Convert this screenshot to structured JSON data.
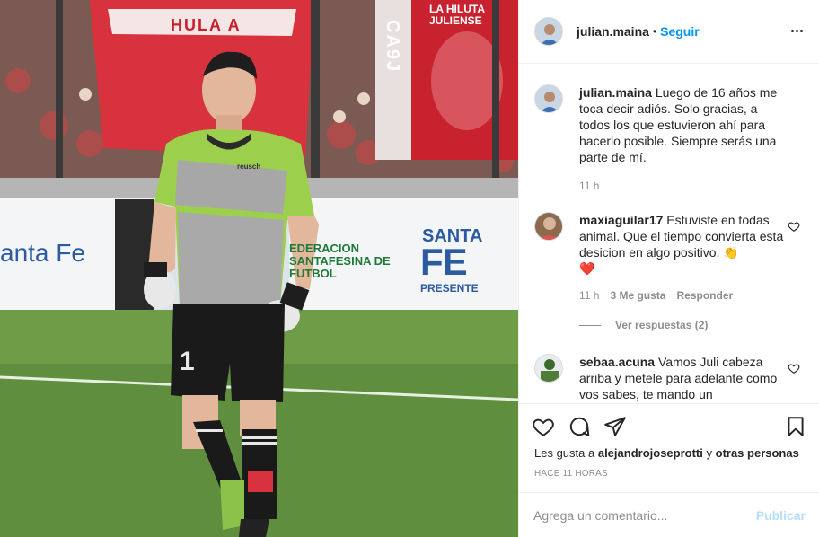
{
  "photo": {
    "banners": {
      "left": "HULA A",
      "right_vertical": "CA9J",
      "right_top": "LA HILUTA JULIENSE"
    },
    "boards": {
      "santa_fe": "anta Fe",
      "federacion": "EDERACION SANTAFESINA DE FUTBOL",
      "santa": "SANTA",
      "fe": "FE",
      "presente": "PRESENTE"
    },
    "kit": {
      "brand": "reusch",
      "number": "1"
    }
  },
  "header": {
    "username": "julian.maina",
    "separator": "•",
    "follow_label": "Seguir",
    "more_icon": "more-horizontal-icon"
  },
  "caption": {
    "username": "julian.maina",
    "text": "Luego de 16 años me toca decir adiós. Solo gracias, a todos los que estuvieron ahí para hacerlo posible. Siempre serás una parte de mí.",
    "time": "11 h"
  },
  "comments": [
    {
      "username": "maxiaguilar17",
      "text": "Estuviste en todas animal. Que el tiempo convierta esta desicion en algo positivo. 👏",
      "emoji_line": "❤️",
      "time": "11 h",
      "likes": "3 Me gusta",
      "reply_label": "Responder",
      "view_replies": "Ver respuestas (2)"
    },
    {
      "username": "sebaa.acuna",
      "text": "Vamos Juli cabeza arriba y metele para adelante como vos sabes, te mando un"
    }
  ],
  "actions": {
    "icons": [
      "heart-icon",
      "comment-icon",
      "share-icon",
      "bookmark-icon"
    ],
    "likes_prefix": "Les gusta a",
    "likes_user": "alejandrojoseprotti",
    "likes_connector": "y",
    "likes_others": "otras personas",
    "timestamp": "HACE 11 HORAS"
  },
  "add_comment": {
    "placeholder": "Agrega un comentario...",
    "publish_label": "Publicar"
  },
  "colors": {
    "link_blue": "#0095f6",
    "publish_disabled": "#b2dffc",
    "muted": "#8e8e8e",
    "heart_red": "#ed4956"
  }
}
